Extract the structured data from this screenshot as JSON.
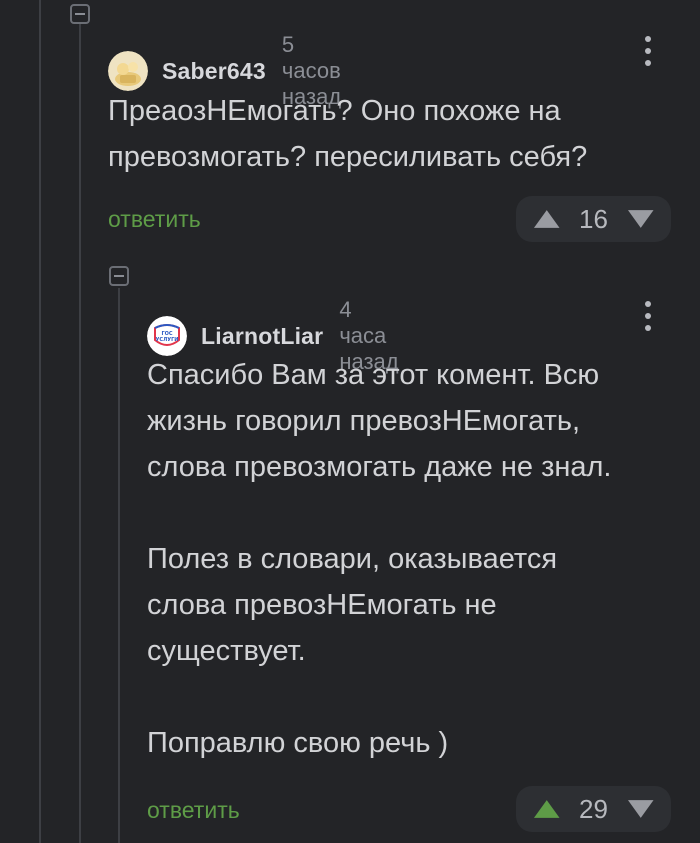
{
  "comments": [
    {
      "username": "Saber643",
      "time": "5 часов назад",
      "avatar_icon": "saber643-avatar-icon",
      "body": "ПреаозНЕмогать? Оно похоже на\nпревозмогать? пересиливать себя?",
      "reply_label": "ответить",
      "score": "16",
      "upvoted": false
    },
    {
      "username": "LiarnotLiar",
      "time": "4 часа назад",
      "avatar_icon": "gosuslugi-logo-icon",
      "avatar_text": "ГОС\nУСЛУГИ",
      "body": "Спасибо Вам за этот комент. Всю\nжизнь говорил превозНЕмогать,\nслова превозмогать даже не знал.\n\nПолез в словари, оказывается\nслова превозНЕмогать не\nсуществует.\n\nПоправлю свою речь )",
      "reply_label": "ответить",
      "score": "29",
      "upvoted": true
    }
  ],
  "colors": {
    "background": "#232427",
    "reply_link": "#5e9c47",
    "upvote_active": "#5e9c47",
    "vote_inactive": "#9a9ca2",
    "rating_bg": "#2d2f33"
  }
}
